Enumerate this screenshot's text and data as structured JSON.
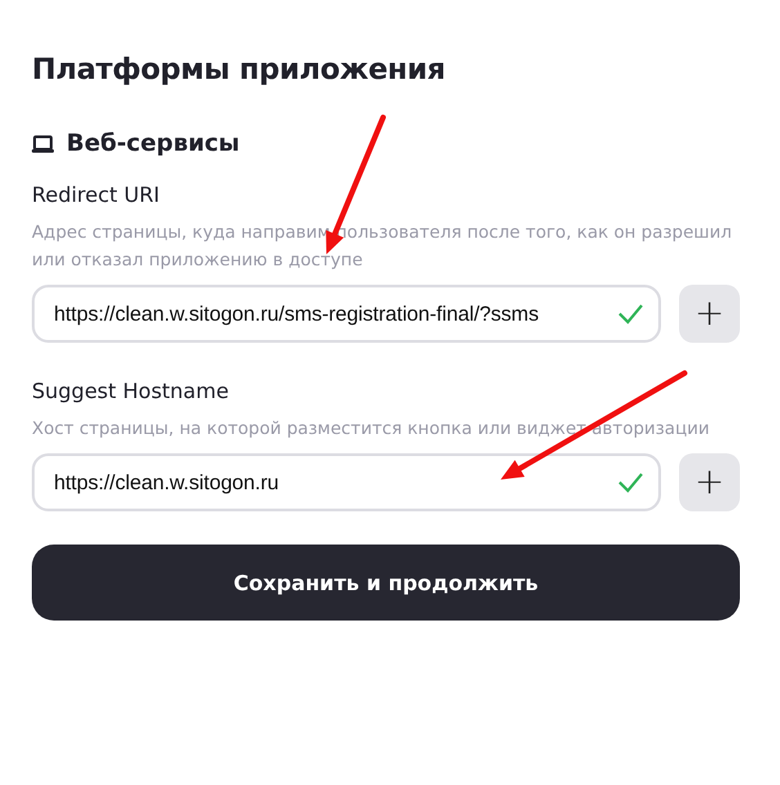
{
  "title": "Платформы приложения",
  "section": {
    "title": "Веб-сервисы"
  },
  "fields": [
    {
      "label": "Redirect URI",
      "hint": "Адрес страницы, куда направим пользователя после того, как он разрешил или отказал приложению в доступе",
      "value": "https://clean.w.sitogon.ru/sms-registration-final/?ssms",
      "valid": true,
      "add_button": "+"
    },
    {
      "label": "Suggest Hostname",
      "hint": "Хост страницы, на которой разместится кнопка или виджет авторизации",
      "value": "https://clean.w.sitogon.ru",
      "valid": true,
      "add_button": "+"
    }
  ],
  "submit_button": "Сохранить и продолжить",
  "annotations": [
    {
      "kind": "arrow"
    },
    {
      "kind": "arrow"
    }
  ]
}
